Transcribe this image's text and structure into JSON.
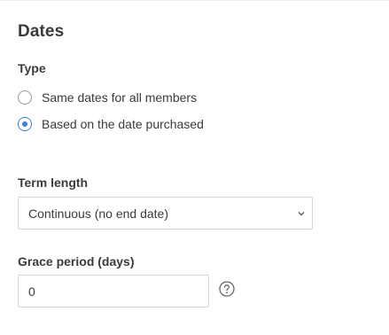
{
  "section": {
    "title": "Dates"
  },
  "type_field": {
    "label": "Type",
    "options": [
      {
        "label": "Same dates for all members",
        "checked": false
      },
      {
        "label": "Based on the date purchased",
        "checked": true
      }
    ]
  },
  "term_length": {
    "label": "Term length",
    "selected": "Continuous (no end date)",
    "icon": "chevron-down-icon"
  },
  "grace_period": {
    "label": "Grace period (days)",
    "value": "0",
    "help_icon": "question-circle-icon"
  },
  "colors": {
    "accent": "#3b7ddd",
    "border": "#d5d5d5",
    "text": "#3a3a3a"
  }
}
